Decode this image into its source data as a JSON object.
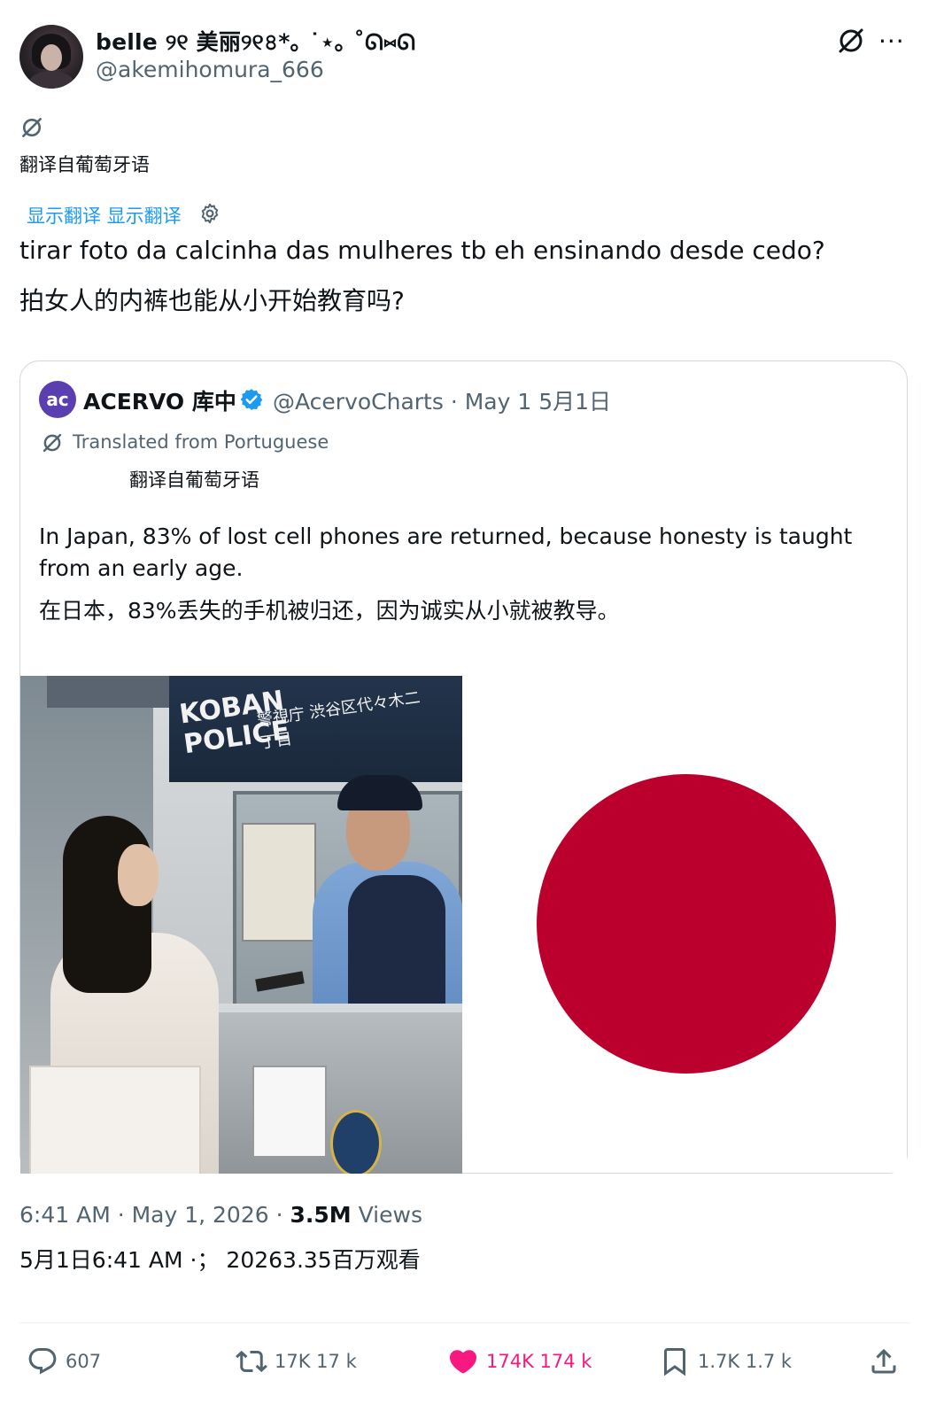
{
  "tweet": {
    "display_name": "belle ୨୧ 美丽୨୧৪*｡ ˙⋆｡ ˚ᘏ⑅ᘏ",
    "handle": "@akemihomura_666",
    "translated_label": "翻译自葡萄牙语",
    "show_translation": "显示翻译 显示翻译",
    "text": "tirar foto da calcinha das mulheres tb eh ensinando desde cedo?",
    "text_translation": "拍女人的内裤也能从小开始教育吗?",
    "more_label": "···"
  },
  "quote": {
    "avatar_text": "ac",
    "name": "ACERVO 库中",
    "handle_date": "@AcervoCharts · May 1 5月1日",
    "translated_from": "Translated from Portuguese",
    "translated_from_cn": "翻译自葡萄牙语",
    "text": "In Japan, 83% of lost cell phones are returned, because honesty is taught from an early age.",
    "text_cn": "在日本，83%丢失的手机被归还，因为诚实从小就被教导。",
    "photo_sign": "KOBAN POLICE",
    "photo_sign_kanji": "警視庁 渋谷区代々木二丁目"
  },
  "meta": {
    "time": "6:41 AM · May 1, 2026 · ",
    "views_count": "3.5M",
    "views_label": " Views",
    "time_cn": "5月1日6:41 AM ·；  20263.35百万观看"
  },
  "actions": {
    "replies": "607",
    "retweets": "17K 17 k",
    "likes": "174K 174 k",
    "bookmarks": "1.7K 1.7 k"
  },
  "colors": {
    "accent": "#1d9bf0",
    "like": "#f91880",
    "flag_red": "#bc002d",
    "muted": "#536471"
  }
}
